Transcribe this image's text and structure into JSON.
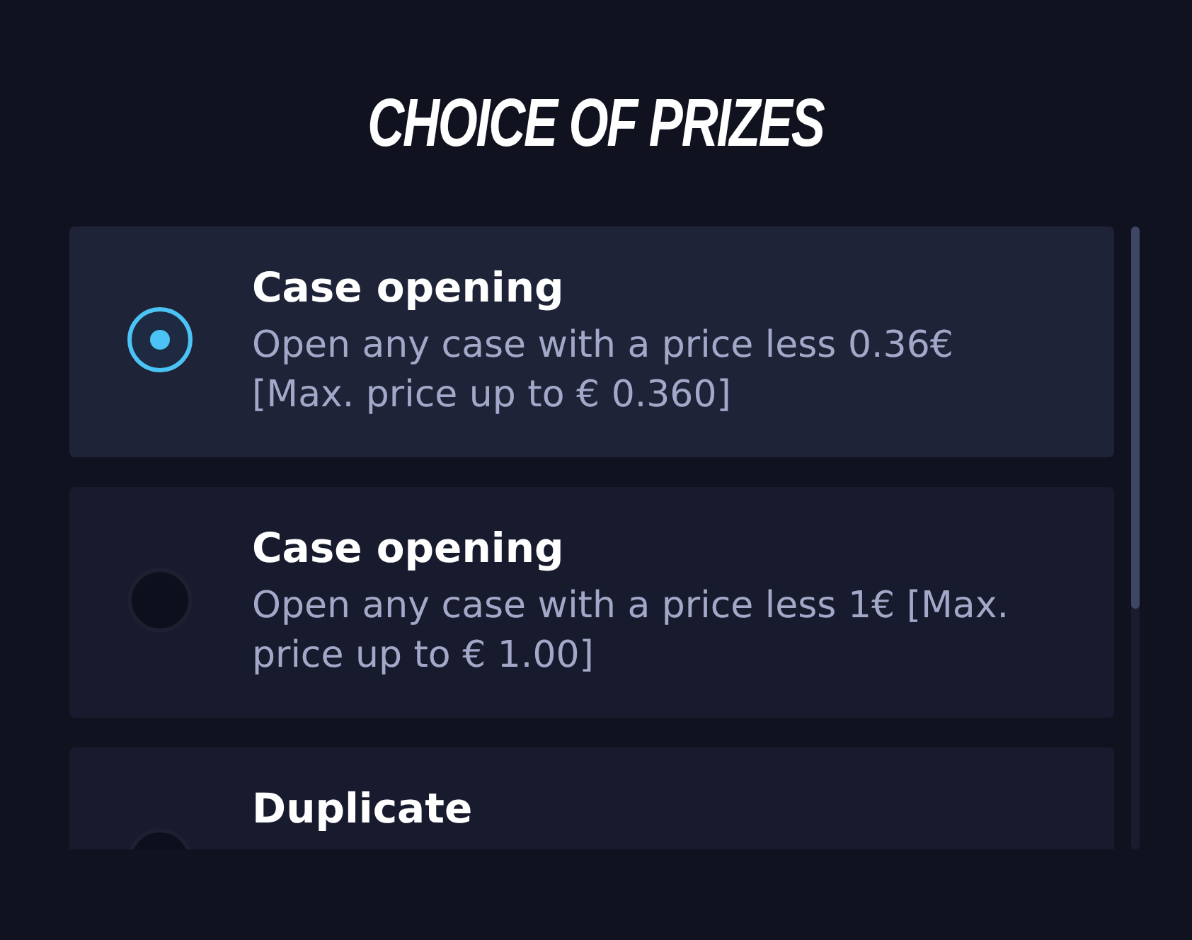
{
  "title": "CHOICE OF PRIZES",
  "options": [
    {
      "title": "Case opening",
      "description": "Open any case with a price less 0.36€ [Max. price up to € 0.360]",
      "selected": true
    },
    {
      "title": "Case opening",
      "description": "Open any case with a price less 1€ [Max. price up to € 1.00]",
      "selected": false
    },
    {
      "title": "Duplicate",
      "selected": false
    }
  ]
}
